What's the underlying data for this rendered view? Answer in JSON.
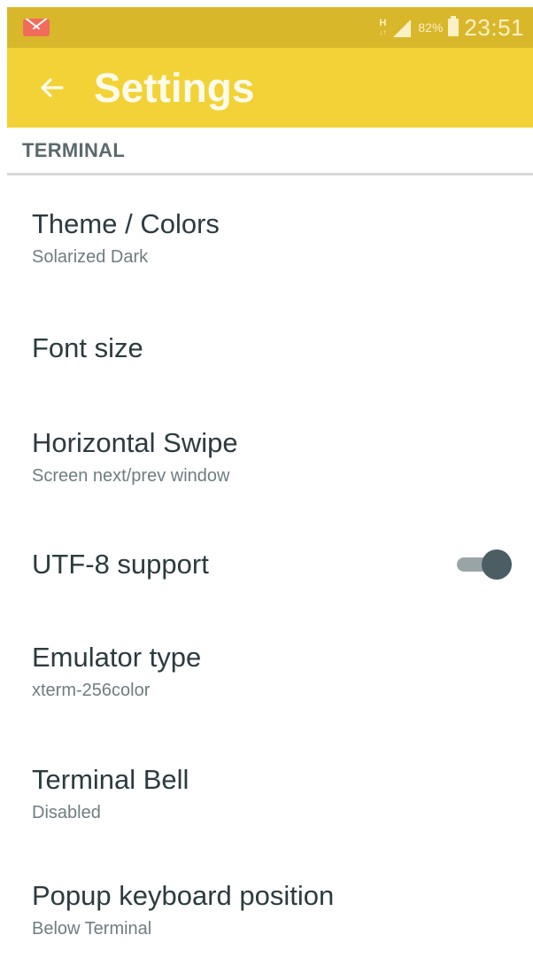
{
  "status_bar": {
    "network_type": "H",
    "battery_percent": "82%",
    "time": "23:51",
    "notification_icon": "gmail-icon"
  },
  "app_bar": {
    "title": "Settings",
    "back_icon": "arrow-back-icon",
    "color": "#f2d236"
  },
  "section": {
    "title": "TERMINAL"
  },
  "preferences": [
    {
      "title": "Theme / Colors",
      "summary": "Solarized Dark"
    },
    {
      "title": "Font size",
      "summary": ""
    },
    {
      "title": "Horizontal Swipe",
      "summary": "Screen next/prev window"
    },
    {
      "title": "UTF-8 support",
      "summary": "",
      "toggle": true,
      "checked": true
    },
    {
      "title": "Emulator type",
      "summary": "xterm-256color"
    },
    {
      "title": "Terminal Bell",
      "summary": "Disabled"
    },
    {
      "title": "Popup keyboard position",
      "summary": "Below Terminal"
    }
  ]
}
